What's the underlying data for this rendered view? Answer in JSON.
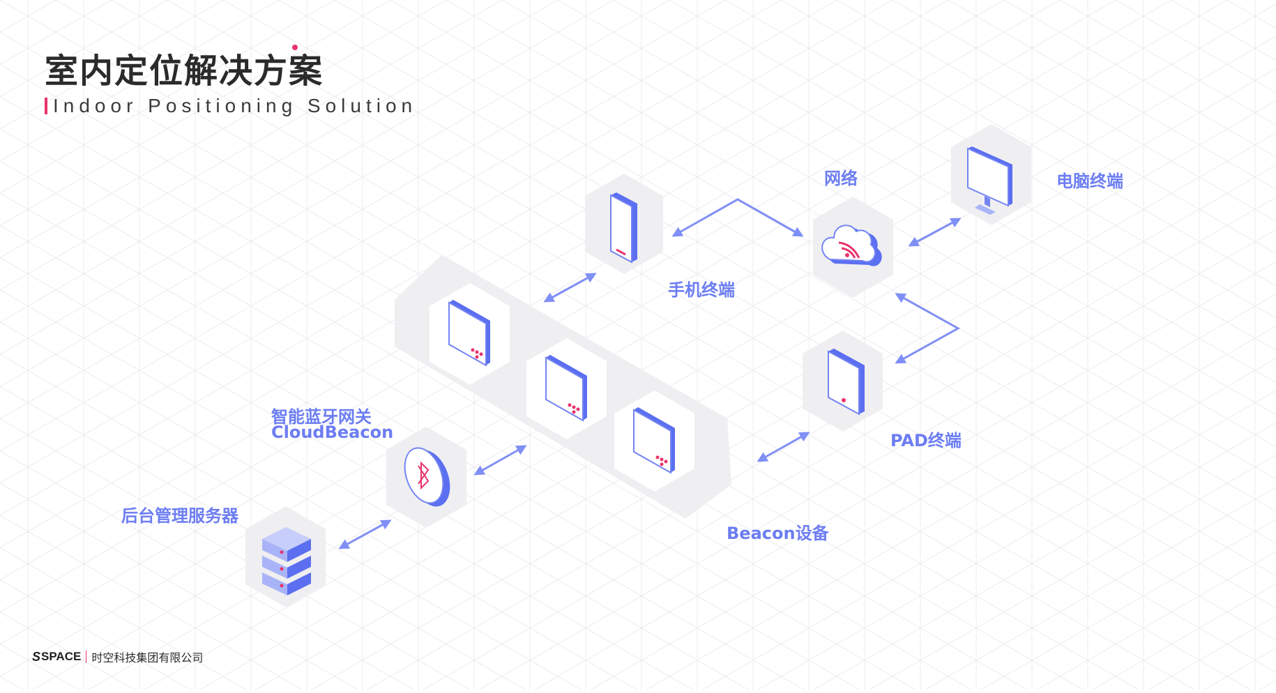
{
  "header": {
    "title_cn": "室内定位解决方案",
    "title_en": "Indoor Positioning Solution"
  },
  "labels": {
    "network": "网络",
    "pc": "电脑终端",
    "phone": "手机终端",
    "pad": "PAD终端",
    "gateway_cn": "智能蓝牙网关",
    "gateway_en": "CloudBeacon",
    "server": "后台管理服务器",
    "beacon": "Beacon设备"
  },
  "footer": {
    "brand_mark": "S",
    "brand": "SPACE",
    "company": "时空科技集团有限公司"
  },
  "colors": {
    "accent_blue": "#6c7df2",
    "accent_pink": "#e8336a",
    "hex_gray": "#eeeeef",
    "device_blue": "#5b6ff0",
    "device_light": "#a9b4f8"
  }
}
